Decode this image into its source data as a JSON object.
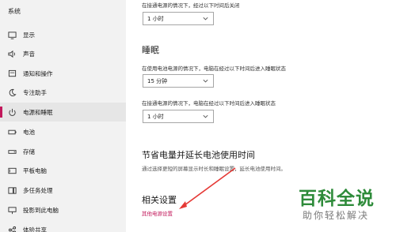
{
  "sidebar": {
    "title": "系统",
    "items": [
      {
        "label": "显示",
        "icon": "monitor-icon"
      },
      {
        "label": "声音",
        "icon": "speaker-icon"
      },
      {
        "label": "通知和操作",
        "icon": "notification-icon"
      },
      {
        "label": "专注助手",
        "icon": "moon-icon"
      },
      {
        "label": "电源和睡眠",
        "icon": "power-icon",
        "active": true
      },
      {
        "label": "电池",
        "icon": "battery-icon"
      },
      {
        "label": "存储",
        "icon": "storage-icon"
      },
      {
        "label": "平板电脑",
        "icon": "tablet-icon"
      },
      {
        "label": "多任务处理",
        "icon": "multitask-icon"
      },
      {
        "label": "投影到此电脑",
        "icon": "project-icon"
      },
      {
        "label": "体验共享",
        "icon": "share-icon"
      }
    ]
  },
  "screen": {
    "hint_plugged": "在接通电源的情况下，经过以下时间后关闭",
    "value_plugged": "1 小时"
  },
  "sleep": {
    "title": "睡眠",
    "hint_battery": "在使用电池电源的情况下，电脑在经过以下时间后进入睡眠状态",
    "value_battery": "15 分钟",
    "hint_plugged": "在接通电源的情况下，电脑在经过以下时间后进入睡眠状态",
    "value_plugged": "1 小时"
  },
  "save_power": {
    "title": "节省电量并延长电池使用时间",
    "description": "通过选择更短的屏幕显示时长和睡眠设置，延长电池使用时间。"
  },
  "related": {
    "title": "相关设置",
    "link": "其他电源设置"
  },
  "watermark": {
    "big": "百科全说",
    "small": "助你轻松解决"
  },
  "colors": {
    "accent": "#c2185b",
    "sidebar_bg": "#f2f2f2",
    "watermark_green": "#2e8b3a",
    "arrow": "#e53935"
  }
}
